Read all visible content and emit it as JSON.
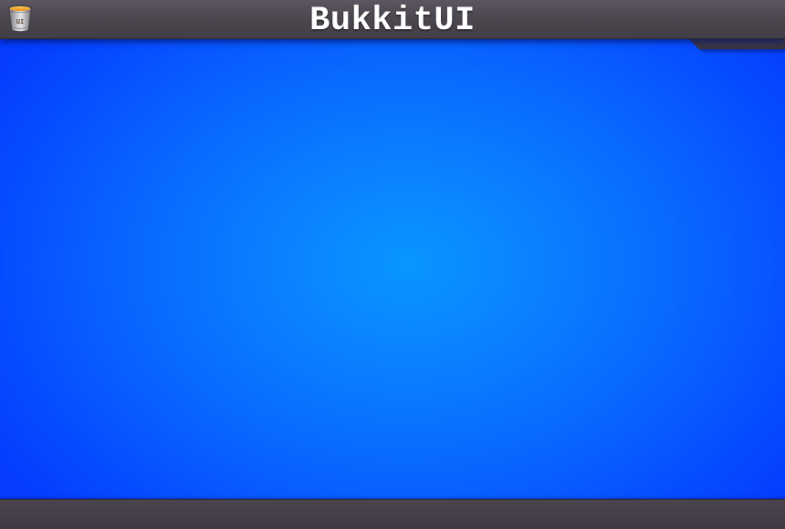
{
  "app": {
    "title": "BukkitUI",
    "logo": {
      "icon": "bucket-icon",
      "label": "UI"
    }
  },
  "colors": {
    "bar_background": "#4a444d",
    "title_text": "#ffffff",
    "background_center": "#0996ff",
    "background_edge": "#053cff"
  }
}
